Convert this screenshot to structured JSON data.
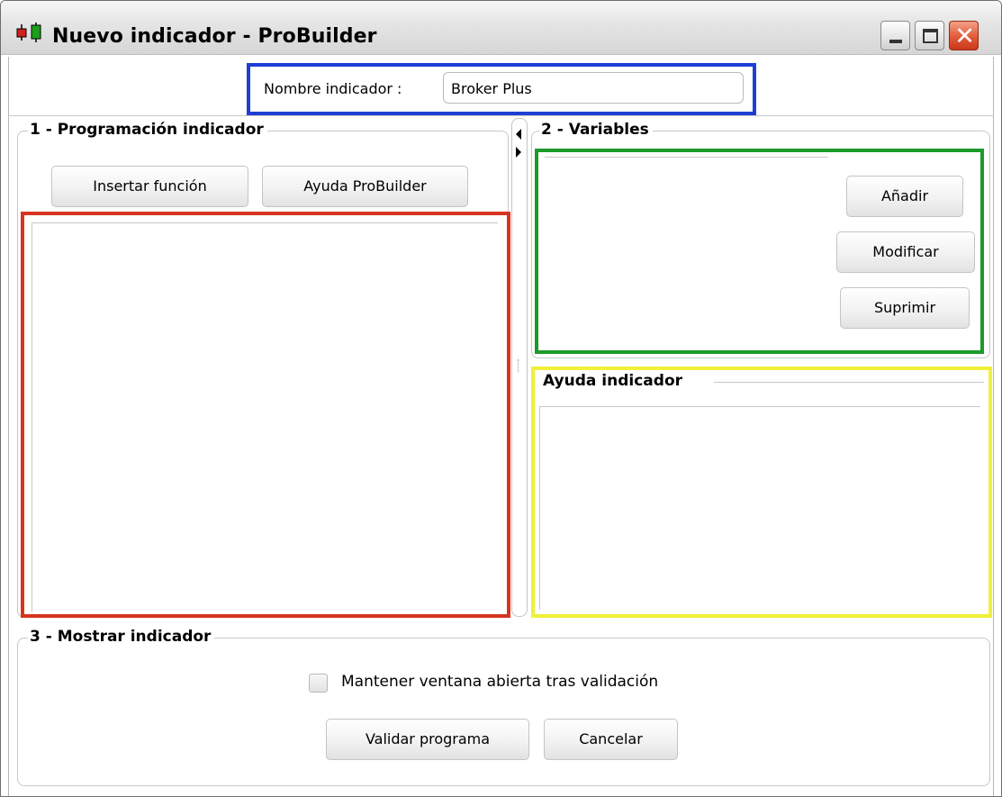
{
  "window": {
    "title": "Nuevo indicador - ProBuilder",
    "icon": "candlestick-chart-icon",
    "icon_colors": {
      "red": "#d21f1f",
      "green": "#1ca01c"
    },
    "controls": {
      "minimize": "minimize-icon",
      "maximize": "maximize-icon",
      "close": "close-icon"
    }
  },
  "name_field": {
    "label": "Nombre indicador :",
    "value": "Broker Plus"
  },
  "section_programming": {
    "title": "1 - Programación indicador",
    "insert_function_label": "Insertar función",
    "help_label": "Ayuda ProBuilder",
    "code": ""
  },
  "section_variables": {
    "title": "2 - Variables",
    "add_label": "Añadir",
    "modify_label": "Modificar",
    "delete_label": "Suprimir",
    "items": []
  },
  "section_help": {
    "title": "Ayuda indicador",
    "text": ""
  },
  "section_display": {
    "title": "3 - Mostrar indicador",
    "keep_open_label": "Mantener ventana abierta tras validación",
    "keep_open_checked": false,
    "validate_label": "Validar programa",
    "cancel_label": "Cancelar"
  },
  "highlight_colors": {
    "name": "#1e3fd6",
    "code": "#d7341f",
    "variables": "#1c9a2a",
    "help": "#f0f03a"
  }
}
